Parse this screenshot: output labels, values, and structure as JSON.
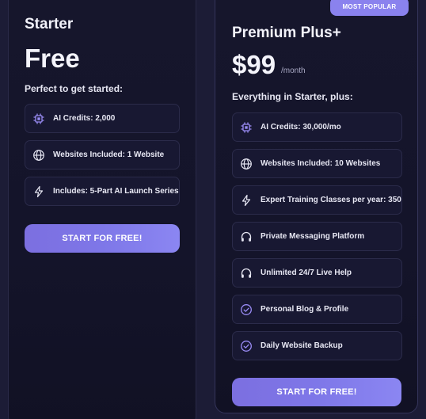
{
  "starter": {
    "title": "Starter",
    "price": "Free",
    "subtitle": "Perfect to get started:",
    "features": [
      {
        "icon": "chip-icon",
        "label": "AI Credits: 2,000"
      },
      {
        "icon": "globe-icon",
        "label": "Websites Included: 1 Website"
      },
      {
        "icon": "lightning-icon",
        "label": "Includes: 5-Part AI Launch Series"
      }
    ],
    "cta_label": "START FOR FREE!"
  },
  "premium": {
    "badge": "MOST POPULAR",
    "title": "Premium Plus+",
    "price": "$99",
    "per": "/month",
    "subtitle": "Everything in Starter, plus:",
    "features": [
      {
        "icon": "chip-icon",
        "label": "AI Credits: 30,000/mo"
      },
      {
        "icon": "globe-icon",
        "label": "Websites Included: 10 Websites"
      },
      {
        "icon": "lightning-icon",
        "label": "Expert Training Classes per year: 350"
      },
      {
        "icon": "headphones-icon",
        "label": "Private Messaging Platform"
      },
      {
        "icon": "headphones-icon",
        "label": "Unlimited 24/7 Live Help"
      },
      {
        "icon": "check-circle-icon",
        "label": "Personal Blog & Profile"
      },
      {
        "icon": "check-circle-icon",
        "label": "Daily Website Backup"
      }
    ],
    "cta_label": "START FOR FREE!"
  },
  "colors": {
    "accent": "#7e77e8",
    "badge": "#8a82ee",
    "background": "#1c1c36",
    "card": "#16162c",
    "icon_purple": "#9a8cf5"
  }
}
